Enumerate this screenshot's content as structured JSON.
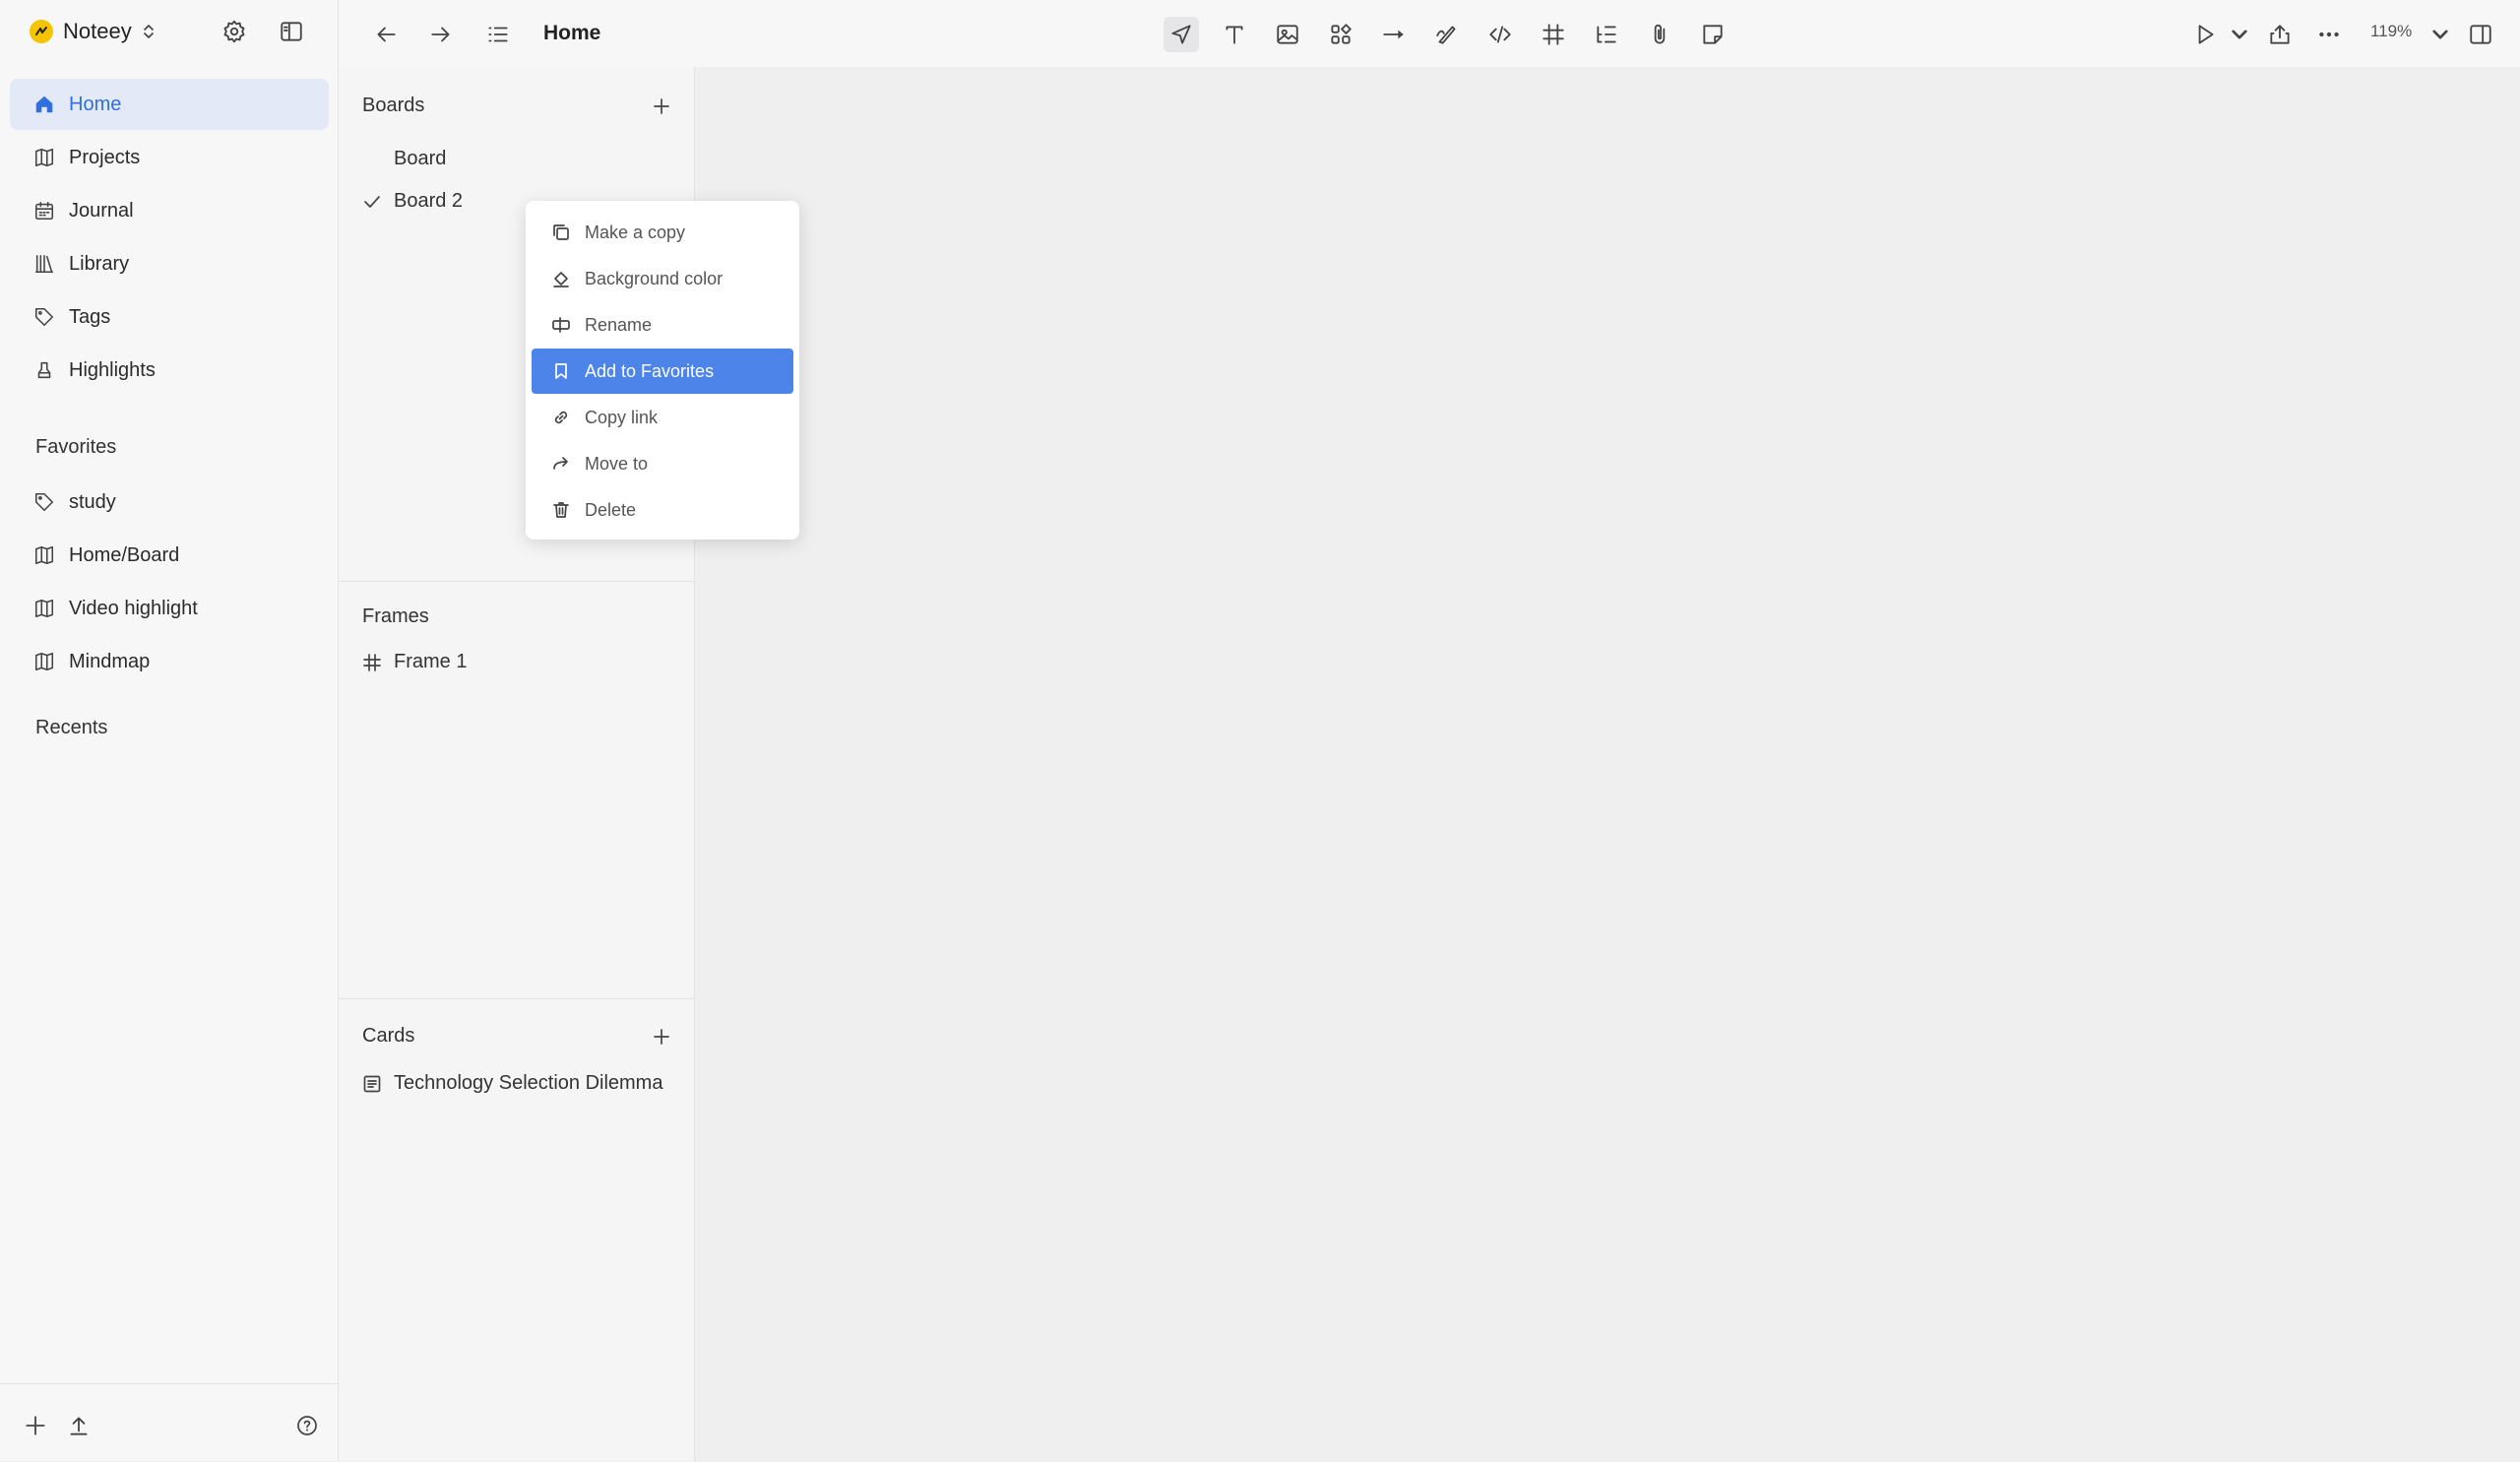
{
  "app": {
    "name": "Noteey"
  },
  "sidebar": {
    "nav": [
      {
        "label": "Home",
        "icon": "home-icon",
        "active": true
      },
      {
        "label": "Projects",
        "icon": "book-icon"
      },
      {
        "label": "Journal",
        "icon": "calendar-icon"
      },
      {
        "label": "Library",
        "icon": "library-icon"
      },
      {
        "label": "Tags",
        "icon": "tag-icon"
      },
      {
        "label": "Highlights",
        "icon": "highlighter-icon"
      }
    ],
    "favorites_title": "Favorites",
    "favorites": [
      {
        "label": "study",
        "icon": "tag-icon"
      },
      {
        "label": "Home/Board",
        "icon": "book-icon"
      },
      {
        "label": "Video highlight",
        "icon": "book-icon"
      },
      {
        "label": "Mindmap",
        "icon": "book-icon"
      }
    ],
    "recents_title": "Recents"
  },
  "toolbar": {
    "title": "Home",
    "zoom": "119%",
    "tools": [
      "select-arrow-icon",
      "text-icon",
      "image-icon",
      "components-icon",
      "connector-arrow-icon",
      "pen-icon",
      "code-icon",
      "frame-icon",
      "list-icon",
      "attachment-icon",
      "sticky-note-icon"
    ]
  },
  "panel": {
    "boards_title": "Boards",
    "boards": [
      {
        "label": "Board",
        "checked": false
      },
      {
        "label": "Board 2",
        "checked": true
      }
    ],
    "frames_title": "Frames",
    "frames": [
      {
        "label": "Frame 1"
      }
    ],
    "cards_title": "Cards",
    "cards": [
      {
        "label": "Technology Selection Dilemma"
      }
    ]
  },
  "context_menu": {
    "items": [
      {
        "label": "Make a copy",
        "icon": "copy-icon"
      },
      {
        "label": "Background color",
        "icon": "paint-bucket-icon"
      },
      {
        "label": "Rename",
        "icon": "rename-icon"
      },
      {
        "label": "Add to Favorites",
        "icon": "bookmark-icon",
        "highlighted": true
      },
      {
        "label": "Copy link",
        "icon": "link-icon"
      },
      {
        "label": "Move to",
        "icon": "move-arrow-icon"
      },
      {
        "label": "Delete",
        "icon": "trash-icon"
      }
    ]
  },
  "colors": {
    "accent": "#4c84ea",
    "active_bg": "#e3e9f6",
    "active_text": "#2f6fe0",
    "logo": "#f5c400"
  }
}
